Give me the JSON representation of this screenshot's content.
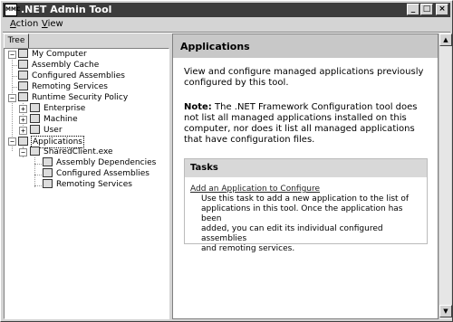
{
  "window": {
    "title": ".NET Admin Tool",
    "app_icon": "mmc-icon",
    "buttons": {
      "minimize": "_",
      "maximize": "□",
      "close": "×"
    }
  },
  "menu": {
    "items": [
      {
        "first": "A",
        "rest": "ction"
      },
      {
        "first": "V",
        "rest": "iew"
      }
    ]
  },
  "tree": {
    "tab_label": "Tree",
    "nodes": [
      {
        "label": "My Computer",
        "icon": "computer-icon"
      },
      {
        "label": "Assembly Cache",
        "icon": "assembly-cache-icon"
      },
      {
        "label": "Configured Assemblies",
        "icon": "configured-assemblies-icon"
      },
      {
        "label": "Remoting Services",
        "icon": "remoting-services-icon"
      },
      {
        "label": "Runtime Security Policy",
        "icon": "security-policy-icon"
      },
      {
        "label": "Enterprise",
        "icon": "enterprise-icon"
      },
      {
        "label": "Machine",
        "icon": "machine-icon"
      },
      {
        "label": "User",
        "icon": "user-icon"
      },
      {
        "label": "Applications",
        "icon": "applications-icon"
      },
      {
        "label": "SharedClient.exe",
        "icon": "application-icon"
      },
      {
        "label": "Assembly Dependencies",
        "icon": "assembly-dependencies-icon"
      },
      {
        "label": "Configured Assemblies",
        "icon": "configured-assemblies-icon"
      },
      {
        "label": "Remoting Services",
        "icon": "remoting-services-icon"
      }
    ],
    "expanders": {
      "minus": "−",
      "plus": "+"
    }
  },
  "content": {
    "title": "Applications",
    "intro_line1": "View and configure managed applications previously",
    "intro_line2": "configured by this tool.",
    "note_label": "Note:",
    "note_line1": " The .NET Framework Configuration tool does",
    "note_line2": "not list all managed applications installed on this",
    "note_line3": "computer, nor does it list all managed applications",
    "note_line4": "that have configuration files.",
    "tasks": {
      "title": "Tasks",
      "link": "Add an Application to Configure",
      "desc_line1": "Use this task to add a new application to the list of",
      "desc_line2": "applications in this tool. Once the application has been",
      "desc_line3": "added, you can edit its individual configured assemblies",
      "desc_line4": "and remoting services."
    }
  },
  "scrollbar": {
    "up": "▲",
    "down": "▼"
  }
}
